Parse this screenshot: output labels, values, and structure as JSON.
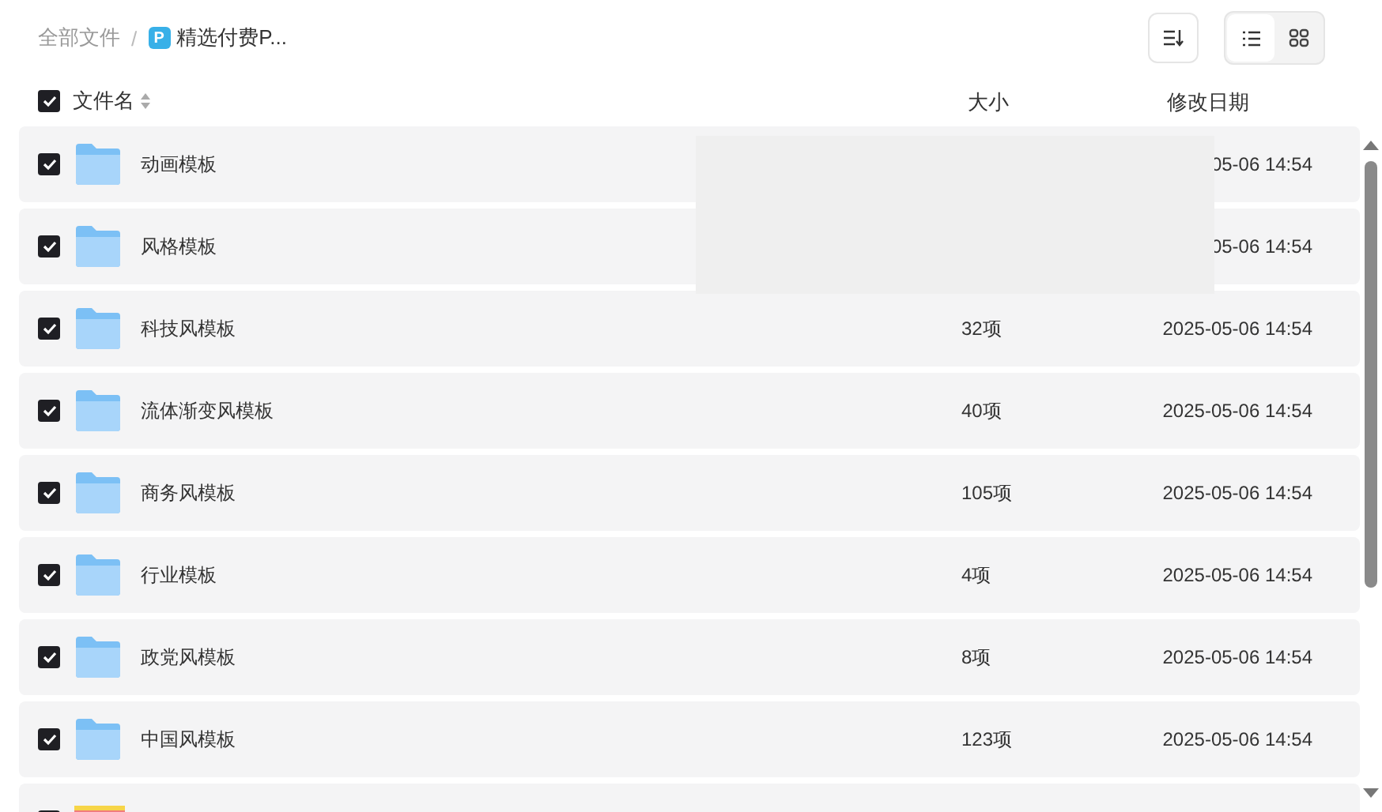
{
  "breadcrumb": {
    "root": "全部文件",
    "separator": "/",
    "current_badge": "P",
    "current": "精选付费P..."
  },
  "toolbar": {
    "view_buttons": [
      {
        "kind": "list",
        "selected": true
      },
      {
        "kind": "grid",
        "selected": false
      }
    ]
  },
  "header": {
    "checked": true,
    "name": "文件名",
    "size": "大小",
    "date": "修改日期"
  },
  "rows": [
    {
      "kind": "folder",
      "checked": true,
      "name": "动画模板",
      "date": "05-06 14:54"
    },
    {
      "kind": "folder",
      "checked": true,
      "name": "风格模板",
      "date": "05-06 14:54"
    },
    {
      "kind": "folder",
      "checked": true,
      "name": "科技风模板",
      "size": "32项",
      "date": "2025-05-06 14:54"
    },
    {
      "kind": "folder",
      "checked": true,
      "name": "流体渐变风模板",
      "size": "40项",
      "date": "2025-05-06 14:54"
    },
    {
      "kind": "folder",
      "checked": true,
      "name": "商务风模板",
      "size": "105项",
      "date": "2025-05-06 14:54"
    },
    {
      "kind": "folder",
      "checked": true,
      "name": "行业模板",
      "size": "4项",
      "date": "2025-05-06 14:54"
    },
    {
      "kind": "folder",
      "checked": true,
      "name": "政党风模板",
      "size": "8项",
      "date": "2025-05-06 14:54"
    },
    {
      "kind": "folder",
      "checked": true,
      "name": "中国风模板",
      "size": "123项",
      "date": "2025-05-06 14:54"
    },
    {
      "kind": "image",
      "checked": true
    }
  ]
}
